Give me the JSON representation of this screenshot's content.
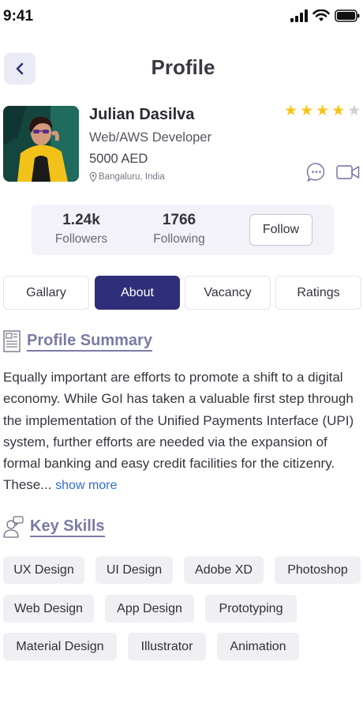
{
  "status_bar": {
    "time": "9:41"
  },
  "header": {
    "title": "Profile"
  },
  "profile": {
    "name": "Julian Dasilva",
    "role": "Web/AWS Developer",
    "rate": "5000 AED",
    "location": "Bangaluru, India",
    "rating": 4,
    "rating_max": 5
  },
  "stats": {
    "followers_value": "1.24k",
    "followers_label": "Followers",
    "following_value": "1766",
    "following_label": "Following",
    "follow_button": "Follow"
  },
  "tabs": [
    {
      "label": "Gallary",
      "active": false
    },
    {
      "label": "About",
      "active": true
    },
    {
      "label": "Vacancy",
      "active": false
    },
    {
      "label": "Ratings",
      "active": false
    }
  ],
  "profile_summary": {
    "title": "Profile Summary",
    "text": "Equally important are efforts to promote a shift to a digital economy. While GoI has taken a valuable first step through the implementation of the Unified Payments Interface (UPI) system, further efforts are needed via the expansion of formal banking and easy credit facilities for the citizenry. These...",
    "show_more": "show more"
  },
  "key_skills": {
    "title": "Key Skills",
    "skills": [
      "UX Design",
      "UI Design",
      "Adobe XD",
      "Photoshop",
      "Web Design",
      "App Design",
      "Prototyping",
      "Material Design",
      "Illustrator",
      "Animation"
    ]
  },
  "colors": {
    "accent": "#2f2e78",
    "section_title": "#7b7aa6",
    "star": "#f5c518",
    "link": "#2f6bd6"
  },
  "icons": [
    "signal-icon",
    "wifi-icon",
    "battery-icon",
    "back-chevron-icon",
    "star-icon",
    "pin-icon",
    "chat-icon",
    "video-icon",
    "summary-doc-icon",
    "skills-user-icon"
  ]
}
